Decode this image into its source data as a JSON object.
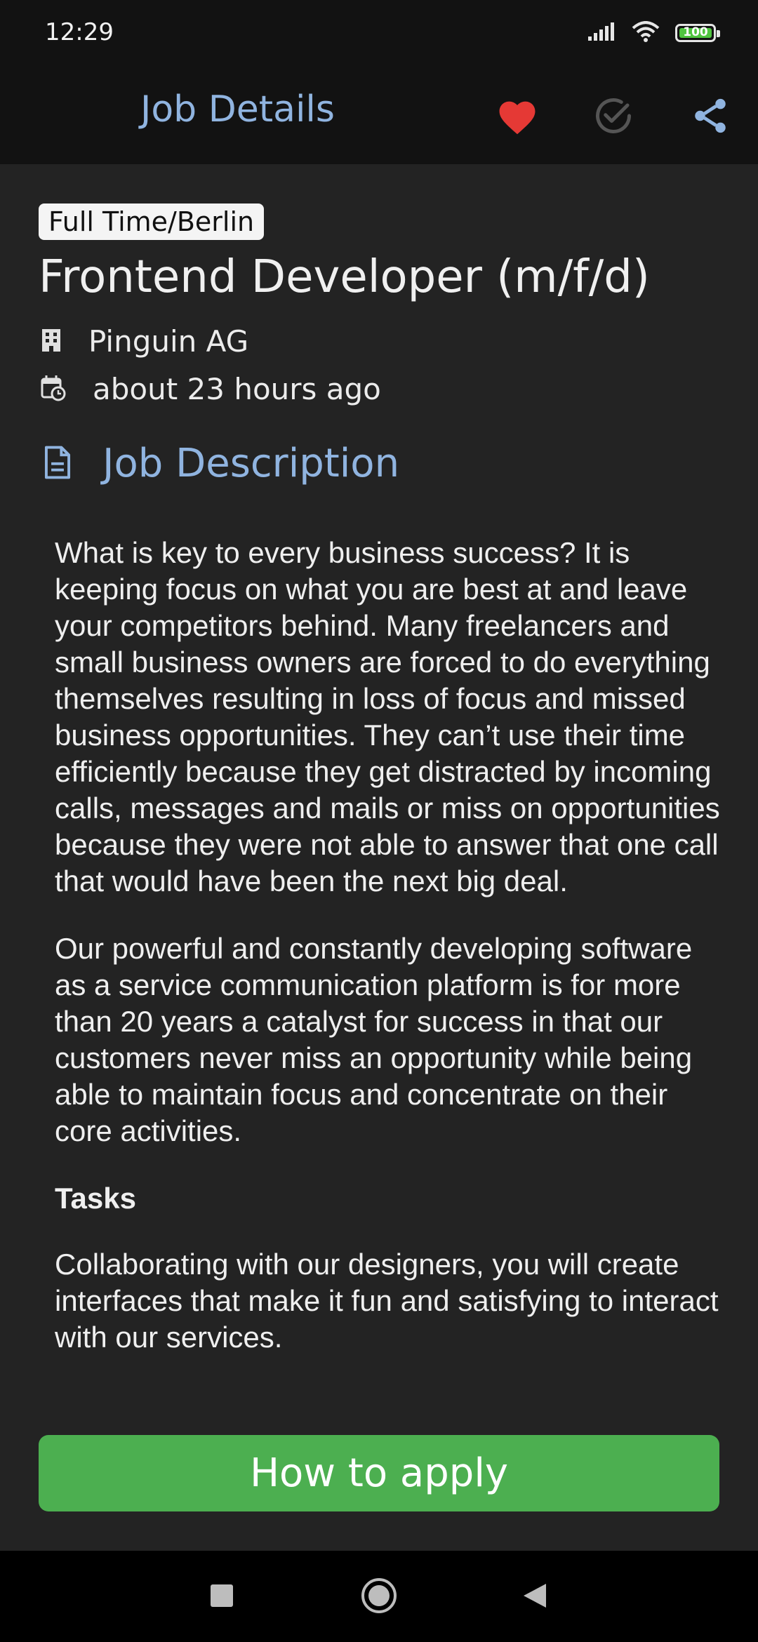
{
  "status_bar": {
    "time": "12:29",
    "battery_level": "100"
  },
  "app_bar": {
    "title": "Job Details",
    "icons": [
      "heart-icon",
      "check-circle-icon",
      "share-icon"
    ],
    "favorite_color": "#e53935"
  },
  "job": {
    "chip": "Full Time/Berlin",
    "title": "Frontend Developer (m/f/d)",
    "company": "Pinguin AG",
    "posted": "about 23 hours ago"
  },
  "section": {
    "title": "Job Description"
  },
  "description": {
    "p1": "What is key to every business success? It is keeping focus on what you are best at and leave your competitors behind. Many freelancers and small business owners are forced to do everything themselves resulting in loss of focus and missed business opportunities. They can’t use their time efficiently because they get distracted by incoming calls, messages and mails or miss on opportunities because they were not able to answer that one call that would have been the next big deal.",
    "p2": "Our powerful and constantly developing software as a service communication platform is for more than 20 years a catalyst for success in that our customers never miss an opportunity while being able to maintain focus and concentrate on their core activities.",
    "tasks_heading": "Tasks",
    "p3": "Collaborating with our designers, you will create interfaces that make it fun and satisfying to interact with our services."
  },
  "apply_button": {
    "label": "How to apply",
    "color": "#4caf50"
  },
  "colors": {
    "accent": "#90b4e0",
    "background": "#232323",
    "bar": "#121212"
  }
}
